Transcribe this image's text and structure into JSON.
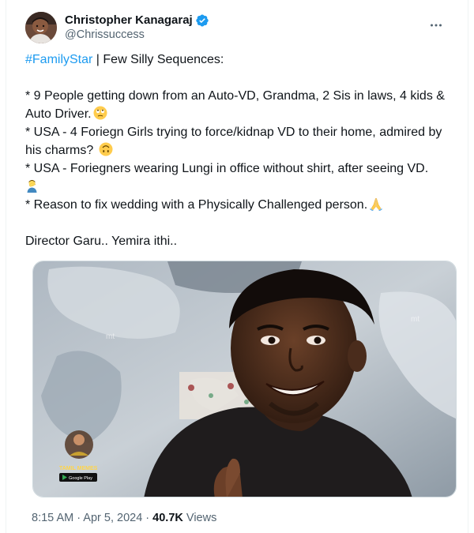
{
  "author": {
    "display_name": "Christopher Kanagaraj",
    "handle": "@Chrissuccess",
    "verified": true,
    "verified_badge_color": "#1d9bf0"
  },
  "menu": {
    "icon": "more-horizontal-icon"
  },
  "tweet": {
    "hashtag": "#FamilyStar",
    "intro_rest": " | Few Silly Sequences:",
    "line1": "* 9 People getting down from an Auto-VD, Grandma, 2 Sis in laws, 4 kids & Auto Driver.",
    "line1_emoji": "face-with-rolling-eyes-emoji",
    "line2": "* USA - 4 Foriegn Girls trying to force/kidnap VD to their home, admired by his charms?",
    "line2_emoji": "upside-down-face-emoji",
    "line3": "* USA - Foriegners wearing Lungi in office without shirt, after seeing VD.",
    "line3_emoji": "man-facepalming-emoji",
    "line4": "* Reason to fix wedding with a Physically Challenged person.",
    "line4_emoji": "folded-hands-emoji",
    "closing": "Director Garu.. Yemira ithi..",
    "hashtag_color": "#1d9bf0"
  },
  "media": {
    "description": "photo-of-smiling-man",
    "watermark_logo": "TAMIL MEMES",
    "watermark_sub": "Google Play",
    "watermark_mark": "mt"
  },
  "meta": {
    "time": "8:15 AM",
    "separator": " · ",
    "date": "Apr 5, 2024",
    "views_count": "40.7K",
    "views_label": " Views"
  }
}
